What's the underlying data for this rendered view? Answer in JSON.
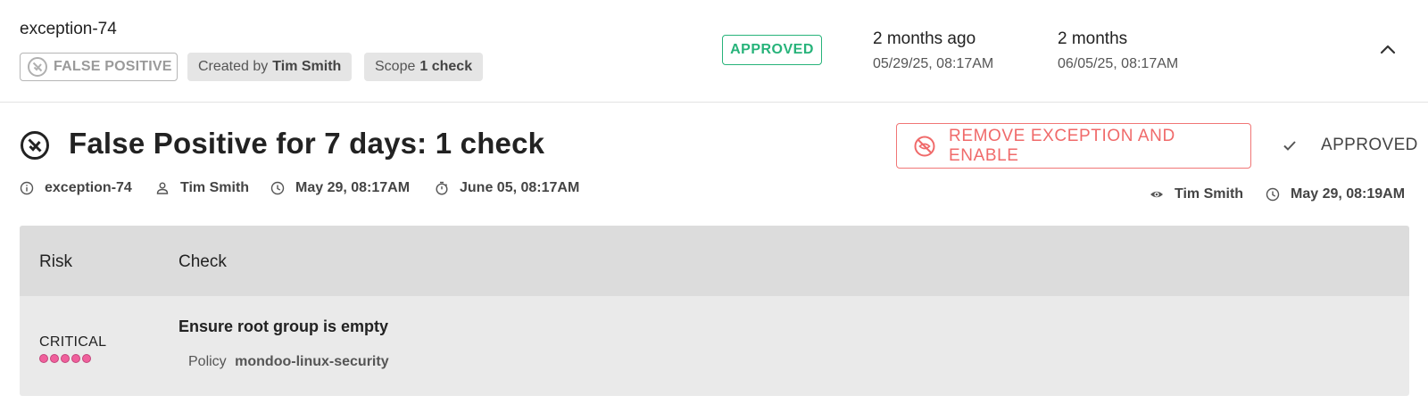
{
  "summary": {
    "exception_id": "exception-74",
    "type_chip": {
      "label": "FALSE POSITIVE",
      "icon": "false-positive-icon"
    },
    "created_chip": {
      "prefix": "Created by",
      "value": "Tim Smith"
    },
    "scope_chip": {
      "prefix": "Scope",
      "value": "1 check"
    },
    "status": "APPROVED",
    "created": {
      "relative": "2 months ago",
      "timestamp": "05/29/25, 08:17AM"
    },
    "duration": {
      "relative": "2 months",
      "timestamp": "06/05/25, 08:17AM"
    },
    "collapse_icon": "chevron-up-icon"
  },
  "detail": {
    "title": "False Positive for 7 days: 1 check",
    "remove_button": {
      "label": "REMOVE EXCEPTION AND ENABLE",
      "icon": "eye-off-icon"
    },
    "approved_label": "APPROVED",
    "meta": {
      "id": "exception-74",
      "author": "Tim Smith",
      "start": "May 29, 08:17AM",
      "end": "June 05, 08:17AM"
    },
    "review": {
      "reviewer": "Tim Smith",
      "reviewed_at": "May 29, 08:19AM"
    }
  },
  "table": {
    "columns": [
      "Risk",
      "Check"
    ],
    "rows": [
      {
        "risk": "CRITICAL",
        "risk_level": 5,
        "risk_color": "#f0609c",
        "check": "Ensure root group is empty",
        "policy_prefix": "Policy",
        "policy": "mondoo-linux-security"
      }
    ]
  },
  "colors": {
    "approved": "#27b37a",
    "danger": "#f06a6a"
  }
}
